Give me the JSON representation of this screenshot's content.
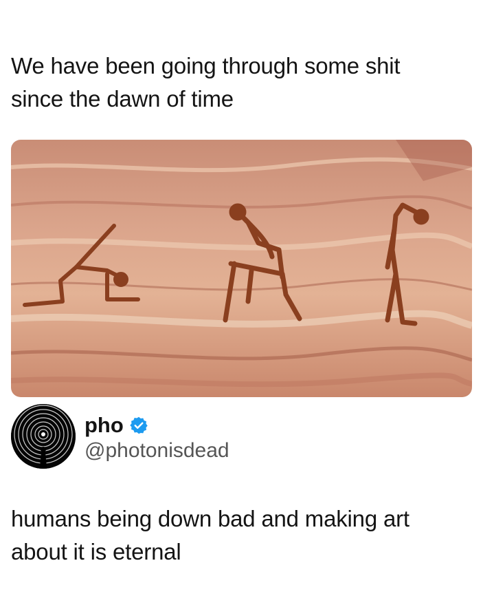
{
  "caption": {
    "line1": "We have been going through some shit",
    "line2": "since the dawn of time"
  },
  "image": {
    "icon": "cave-painting-image",
    "colors": {
      "rock": "#d99a80",
      "paint": "#8a3f1f"
    }
  },
  "post": {
    "display_name": "pho",
    "handle": "@photonisdead",
    "verified_icon": "verified-badge-icon",
    "verified_color": "#1d9bf0",
    "text_line1": "humans being down bad and making art",
    "text_line2": "about it is eternal"
  }
}
